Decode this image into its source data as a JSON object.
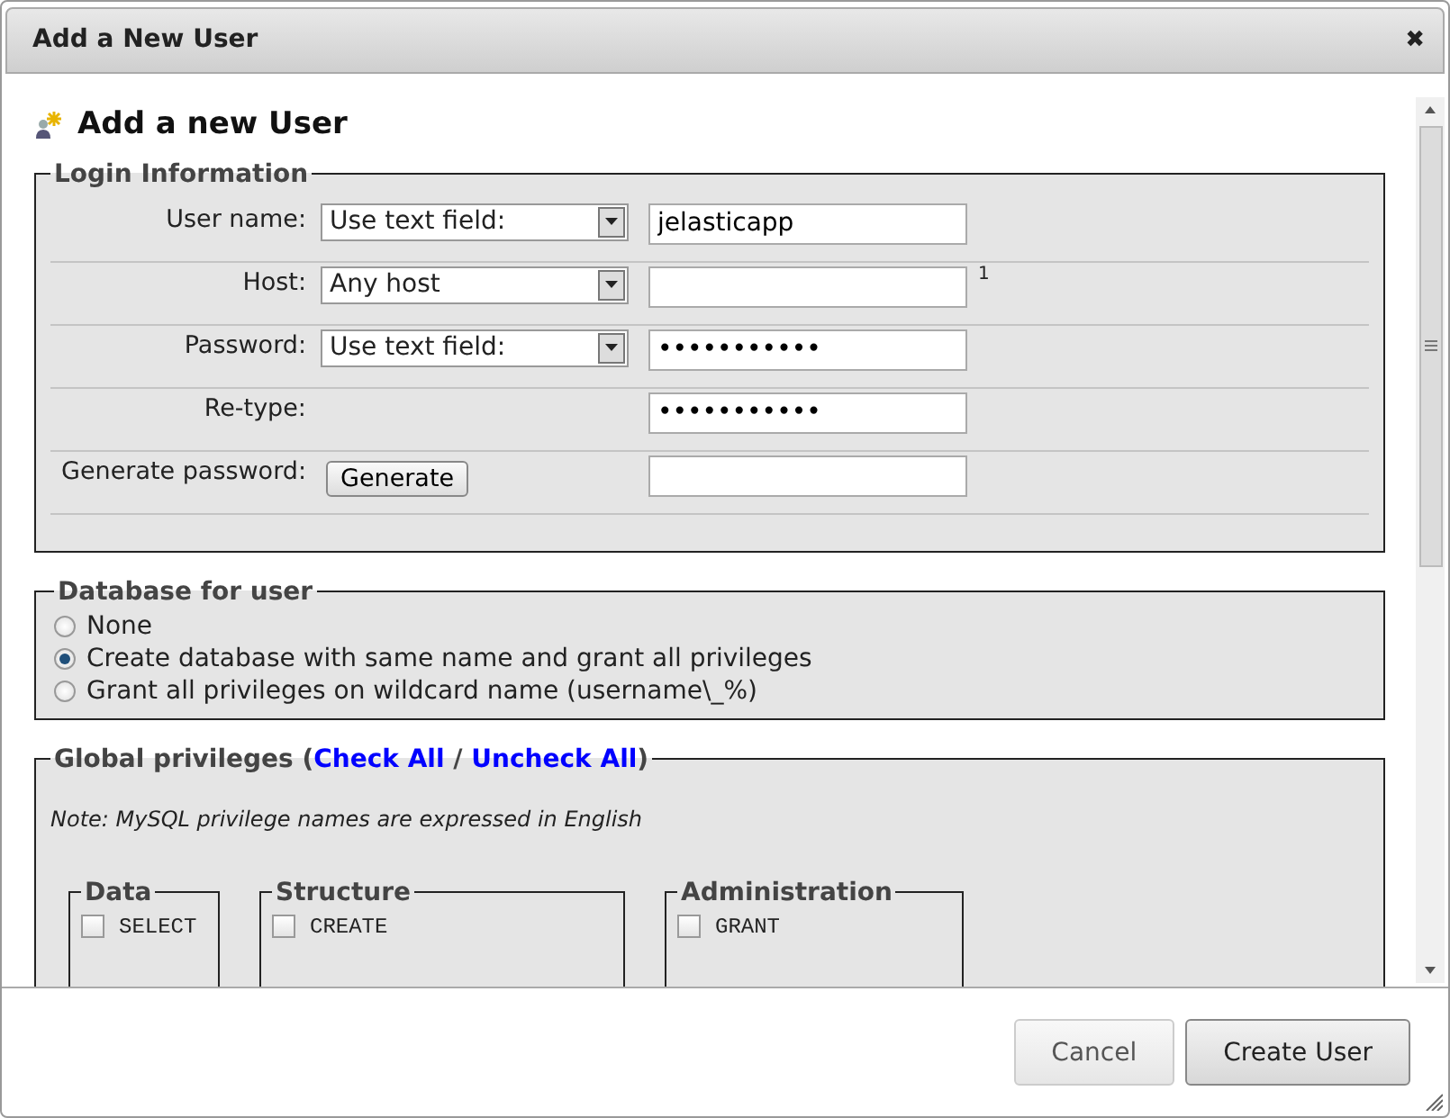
{
  "dialog": {
    "title": "Add a New User",
    "close_symbol": "✖"
  },
  "heading": "Add a new User",
  "login": {
    "legend": "Login Information",
    "rows": [
      {
        "kind": "select-input",
        "label": "User name:",
        "select": "Use text field:",
        "value": "jelasticapp"
      },
      {
        "kind": "select-input",
        "label": "Host:",
        "select": "Any host",
        "note": "1"
      },
      {
        "kind": "select-input",
        "label": "Password:",
        "select": "Use text field:",
        "value": "•••••••••••"
      },
      {
        "kind": "input",
        "label": "Re-type:",
        "value": "•••••••••••"
      },
      {
        "kind": "button-input",
        "label": "Generate password:",
        "button": "Generate"
      }
    ]
  },
  "database": {
    "legend": "Database for user",
    "options": [
      {
        "label": "None",
        "selected": false
      },
      {
        "label": "Create database with same name and grant all privileges",
        "selected": true
      },
      {
        "label": "Grant all privileges on wildcard name (username\\_%)",
        "selected": false
      }
    ]
  },
  "privileges": {
    "title": "Global privileges (",
    "check_all": "Check All",
    "separator": "/",
    "uncheck_all": "Uncheck All",
    "closing": ")",
    "note": "Note: MySQL privilege names are expressed in English",
    "groups": [
      {
        "legend": "Data",
        "items": [
          {
            "label": "SELECT",
            "checked": false
          }
        ]
      },
      {
        "legend": "Structure",
        "items": [
          {
            "label": "CREATE",
            "checked": false
          }
        ]
      },
      {
        "legend": "Administration",
        "items": [
          {
            "label": "GRANT",
            "checked": false
          }
        ]
      }
    ]
  },
  "buttons": [
    {
      "label": "Cancel",
      "kind": "secondary"
    },
    {
      "label": "Create User",
      "kind": "primary"
    }
  ]
}
